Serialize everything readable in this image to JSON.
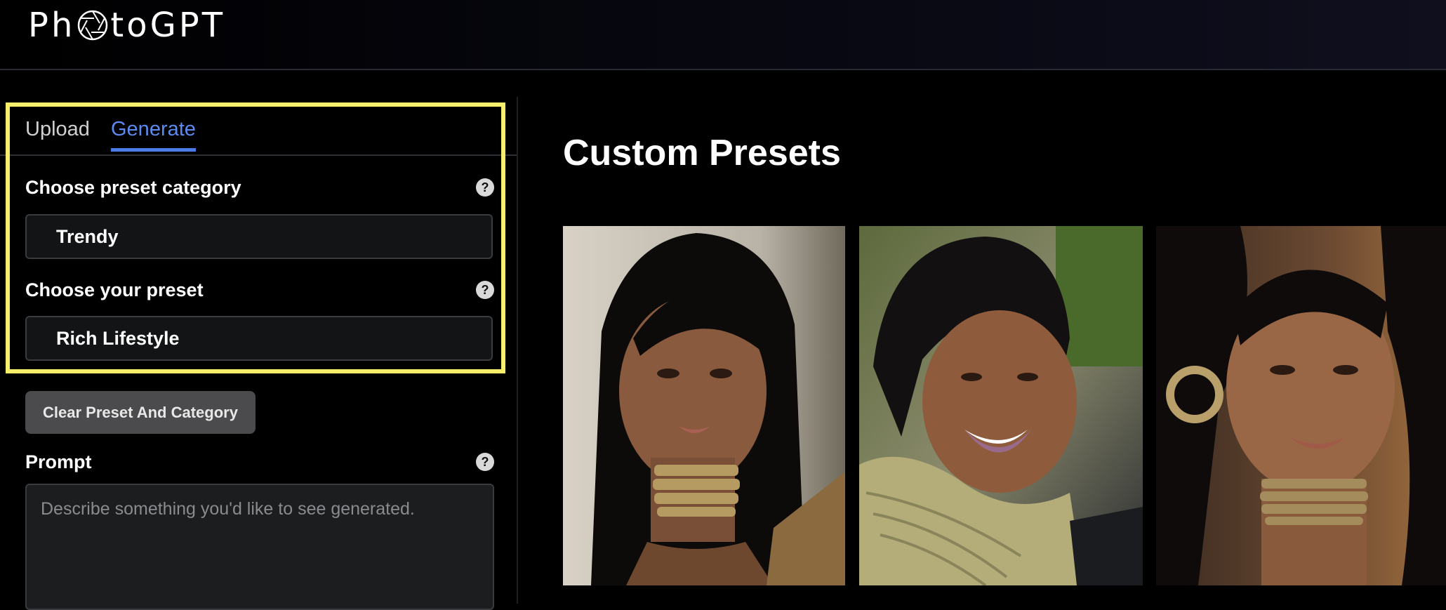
{
  "app": {
    "logo_prefix": "Ph",
    "logo_suffix": "toGPT",
    "logo_icon": "aperture-icon"
  },
  "sidebar": {
    "tabs": [
      {
        "label": "Upload",
        "active": false
      },
      {
        "label": "Generate",
        "active": true
      }
    ],
    "category": {
      "label": "Choose preset category",
      "value": "Trendy",
      "help_icon": "help-icon"
    },
    "preset": {
      "label": "Choose your preset",
      "value": "Rich Lifestyle",
      "help_icon": "help-icon"
    },
    "clear_button": "Clear Preset And Category",
    "prompt": {
      "label": "Prompt",
      "placeholder": "Describe something you'd like to see generated.",
      "value": "",
      "help_icon": "help-icon"
    }
  },
  "main": {
    "title": "Custom Presets",
    "images": [
      {
        "name": "preset-image-1"
      },
      {
        "name": "preset-image-2"
      },
      {
        "name": "preset-image-3"
      }
    ]
  },
  "colors": {
    "accent": "#4a7be8",
    "highlight": "#f7ee6a",
    "background": "#000000"
  }
}
